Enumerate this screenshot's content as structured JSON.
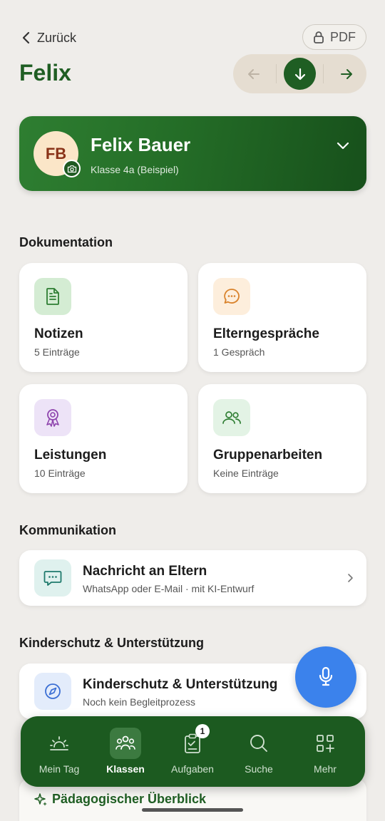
{
  "header": {
    "back_label": "Zurück",
    "pdf_label": "PDF",
    "title": "Felix"
  },
  "profile": {
    "initials": "FB",
    "name": "Felix Bauer",
    "class_label": "Klasse 4a (Beispiel)"
  },
  "sections": {
    "documentation": "Dokumentation",
    "communication": "Kommunikation",
    "child_protection": "Kinderschutz & Unterstützung"
  },
  "tiles": [
    {
      "title": "Notizen",
      "subtitle": "5 Einträge",
      "icon": "document-icon",
      "icon_bg": "#d4ecd3",
      "icon_color": "#2e7d32"
    },
    {
      "title": "Elterngespräche",
      "subtitle": "1 Gespräch",
      "icon": "chat-bubble-icon",
      "icon_bg": "#fdeedc",
      "icon_color": "#d9822b"
    },
    {
      "title": "Leistungen",
      "subtitle": "10 Einträge",
      "icon": "award-icon",
      "icon_bg": "#ede3f7",
      "icon_color": "#8e44ad"
    },
    {
      "title": "Gruppenarbeiten",
      "subtitle": "Keine Einträge",
      "icon": "group-icon",
      "icon_bg": "#e3f3e5",
      "icon_color": "#2e7d32"
    }
  ],
  "message_card": {
    "title": "Nachricht an Eltern",
    "subtitle": "WhatsApp oder E-Mail · mit KI-Entwurf"
  },
  "protection_card": {
    "title": "Kinderschutz & Unterstützung",
    "subtitle": "Noch kein Begleitprozess"
  },
  "overview_card": {
    "title": "Pädagogischer Überblick"
  },
  "bottom_nav": {
    "items": [
      {
        "label": "Mein Tag",
        "icon": "sunrise-icon"
      },
      {
        "label": "Klassen",
        "icon": "people-icon",
        "active": true
      },
      {
        "label": "Aufgaben",
        "icon": "clipboard-check-icon",
        "badge": "1"
      },
      {
        "label": "Suche",
        "icon": "search-icon"
      },
      {
        "label": "Mehr",
        "icon": "grid-plus-icon"
      }
    ]
  },
  "colors": {
    "brand_green": "#1f5e23",
    "nav_green": "#1c5a20",
    "fab_blue": "#3b82ec",
    "background": "#efedea"
  }
}
